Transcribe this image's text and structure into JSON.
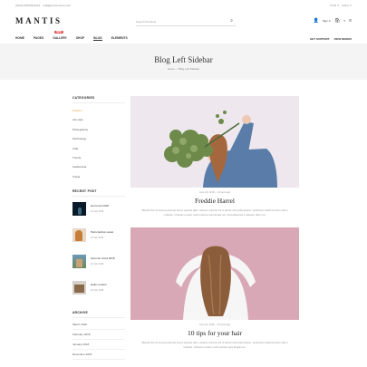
{
  "topbar": {
    "phone": "(0123) 456789 0123",
    "email": "mail@ecommerce.com",
    "currency": "USD",
    "language": "ENG"
  },
  "header": {
    "logo": "MANTIS",
    "search_placeholder": "Search Products",
    "signin": "Sign in",
    "cart_count": "0"
  },
  "nav": {
    "items": [
      {
        "label": "HOME"
      },
      {
        "label": "PAGES"
      },
      {
        "label": "GALLERY",
        "badge": "NEW"
      },
      {
        "label": "SHOP"
      },
      {
        "label": "BLOG"
      },
      {
        "label": "ELEMENTS"
      }
    ],
    "right": [
      "GET SUPPORT",
      "VIEW DEMOS"
    ]
  },
  "banner": {
    "title": "Blog Left Sidebar",
    "home": "Home",
    "sep": "/",
    "current": "Blog Left Sidebar"
  },
  "sidebar": {
    "categories_title": "CATEGORIES",
    "categories": [
      "Fashion",
      "Life style",
      "Photography",
      "Technology",
      "Cafe",
      "Trends",
      "Fashionista",
      "Travel"
    ],
    "recent_title": "RECENT POST",
    "recent": [
      {
        "name": "Hot trend 2018",
        "date": "22 July 2018"
      },
      {
        "name": "Paris fashion week",
        "date": "22 July 2018"
      },
      {
        "name": "Summer trend 2018",
        "date": "22 July 2018"
      },
      {
        "name": "Hello London",
        "date": "22 July 2018"
      }
    ],
    "archive_title": "ARCHIVE",
    "archive": [
      "March 2018",
      "February 2018",
      "January 2018",
      "December 2018"
    ]
  },
  "posts": [
    {
      "meta": "June 20, 2018 — 6 hours ago",
      "title": "Freddie Harrel",
      "excerpt": "Blandit nibh sit tempus placerat donec egestas diam. Aliquam pulvinar elit ut lacinia velit pellentesque. Vestibulum eleifend porta nulla a molestie. Volutpat ut etiam morbi pulvinar quis feugiat nec. Sed adipiscing in aliquam diam nisi."
    },
    {
      "meta": "June 20, 2018 — 6 hours ago",
      "title": "10 tips for your hair",
      "excerpt": "Blandit nibh sit tempus placerat donec egestas diam. Aliquam pulvinar elit ut lacinia velit pellentesque. Vestibulum eleifend porta nulla a molestie. Volutpat ut etiam morbi pulvinar quis feugiat nec."
    }
  ]
}
